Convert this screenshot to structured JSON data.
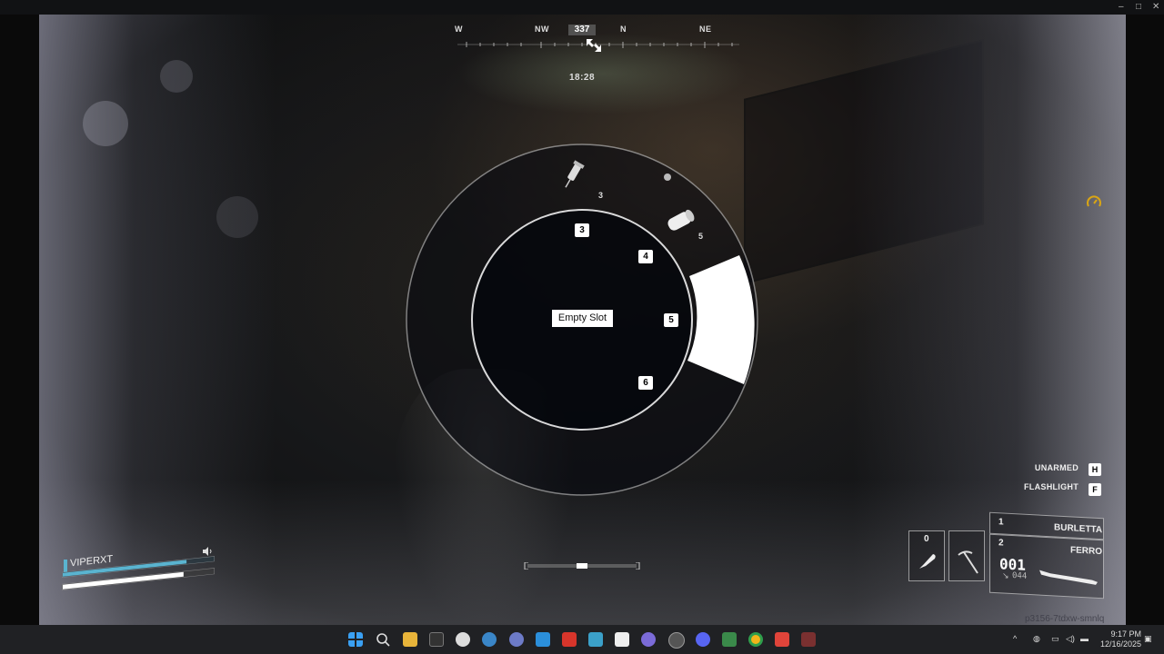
{
  "compass": {
    "letters": [
      "W",
      "NW",
      "N",
      "NE"
    ],
    "heading": "337"
  },
  "clock": "18:28",
  "wheel": {
    "center_label": "Empty Slot",
    "slots": [
      "3",
      "4",
      "5",
      "6"
    ],
    "outer_items": [
      {
        "icon": "syringe-icon",
        "count": "3"
      },
      {
        "icon": "bandage-icon",
        "count": "5"
      }
    ]
  },
  "hotkeys": [
    {
      "label": "UNARMED",
      "key": "H"
    },
    {
      "label": "FLASHLIGHT",
      "key": "F"
    }
  ],
  "player": {
    "name": "VIPERXT",
    "health_fraction": 0.82,
    "stamina_fraction": 0.8
  },
  "inventory": {
    "melee_slot": "0",
    "weapons": [
      {
        "slot": "1",
        "name": "BURLETTA"
      },
      {
        "slot": "2",
        "name": "FERRO"
      }
    ],
    "ammo_loaded": "001",
    "ammo_reserve": "044"
  },
  "session_id": "p3156-7tdxw-smnlq",
  "taskbar": {
    "time": "9:17 PM",
    "date": "12/16/2025"
  },
  "colors": {
    "accent_blue": "#5ab4d0",
    "status_yellow": "#d9a514",
    "selected_segment": "#ffffff"
  }
}
